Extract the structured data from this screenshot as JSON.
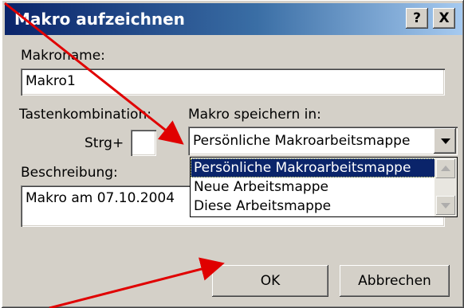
{
  "window": {
    "title": "Makro aufzeichnen",
    "help_label": "?",
    "close_label": "X"
  },
  "form": {
    "macro_name_label": "Makroname:",
    "macro_name_value": "Makro1",
    "shortcut_label": "Tastenkombination:",
    "shortcut_prefix": "Strg+",
    "shortcut_value": "",
    "store_in_label": "Makro speichern in:",
    "store_in_selected": "Persönliche Makroarbeitsmappe",
    "store_in_options": [
      "Persönliche Makroarbeitsmappe",
      "Neue Arbeitsmappe",
      "Diese Arbeitsmappe"
    ],
    "description_label": "Beschreibung:",
    "description_value": "Makro am 07.10.2004"
  },
  "buttons": {
    "ok_label": "OK",
    "cancel_label": "Abbrechen"
  },
  "annotations": {
    "arrow_color": "#e00000"
  },
  "colors": {
    "titlebar": "#0a246a",
    "selection": "#0a246a",
    "face": "#d4d0c8"
  }
}
